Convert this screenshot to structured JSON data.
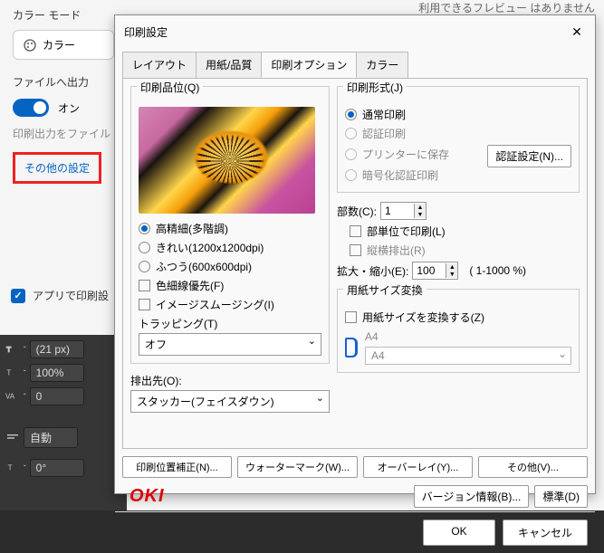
{
  "bg": {
    "color_mode_label": "カラー モード",
    "color_btn": "カラー",
    "output_file_label": "ファイルへ出力",
    "on_label": "オン",
    "output_desc": "印刷出力をファイル",
    "other_settings": "その他の設定",
    "app_print": "アプリで印刷設",
    "preview_na": "利用できるフレビュー はありません"
  },
  "tools": {
    "size": "(21 px)",
    "pct": "100%",
    "zero": "0",
    "auto": "自動",
    "deg": "0°"
  },
  "dlg": {
    "title": "印刷設定",
    "tabs": [
      "レイアウト",
      "用紙/品質",
      "印刷オプション",
      "カラー"
    ],
    "quality": {
      "title": "印刷品位(Q)",
      "r1": "高精細(多階調)",
      "r2": "きれい(1200x1200dpi)",
      "r3": "ふつう(600x600dpi)",
      "c1": "色細線優先(F)",
      "c2": "イメージスムージング(I)"
    },
    "trapping": {
      "label": "トラッピング(T)",
      "value": "オフ"
    },
    "dest": {
      "label": "排出先(O):",
      "value": "スタッカー(フェイスダウン)"
    },
    "format": {
      "title": "印刷形式(J)",
      "r1": "通常印刷",
      "r2": "認証印刷",
      "r3": "プリンターに保存",
      "r4": "暗号化認証印刷",
      "auth_btn": "認証設定(N)..."
    },
    "copies": {
      "label": "部数(C):",
      "value": "1",
      "c1": "部単位で印刷(L)",
      "c2": "縦横排出(R)"
    },
    "scale": {
      "label": "拡大・縮小(E):",
      "value": "100",
      "range": "( 1-1000 %)"
    },
    "paper": {
      "title": "用紙サイズ変換",
      "c1": "用紙サイズを変換する(Z)",
      "a4": "A4",
      "a4sel": "A4"
    },
    "btns": {
      "pos": "印刷位置補正(N)...",
      "water": "ウォーターマーク(W)...",
      "overlay": "オーバーレイ(Y)...",
      "other": "その他(V)...",
      "ver": "バージョン情報(B)...",
      "std": "標準(D)"
    },
    "brand": "OKI",
    "ok": "OK",
    "cancel": "キャンセル"
  }
}
